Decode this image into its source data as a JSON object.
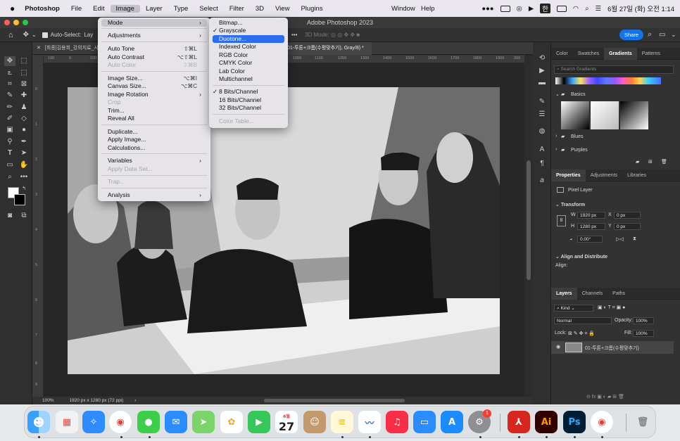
{
  "menubar": {
    "app": "Photoshop",
    "items": [
      "File",
      "Edit",
      "Image",
      "Layer",
      "Type",
      "Select",
      "Filter",
      "3D",
      "View",
      "Plugins",
      "Window",
      "Help"
    ],
    "clock": "6월 27일 (화) 오전 1:14",
    "input_badge": "한"
  },
  "window": {
    "title": "Adobe Photoshop 2023"
  },
  "options": {
    "auto_select": "Auto-Select:",
    "auto_select_value": "Lay",
    "mode3d": "3D Mode:",
    "share": "Share"
  },
  "document": {
    "tab_inactive": "[최종]김용희_강의지료_사진",
    "tab_active": "01-투톤+크롬(수평맞추기), Gray/8) *",
    "zoom": "100%",
    "doc_info": "1920 px x 1280 px (72 ppi)"
  },
  "ruler": {
    "h": [
      "100",
      "0",
      "100",
      "1000",
      "1100",
      "1200",
      "1300",
      "1400",
      "1500",
      "1600",
      "1700",
      "1800",
      "1900",
      "200"
    ],
    "v": [
      "0",
      "1",
      "2",
      "3",
      "4",
      "5",
      "6",
      "7",
      "8",
      "9",
      "1"
    ]
  },
  "image_menu": [
    {
      "label": "Mode",
      "sc": "",
      "arrow": true,
      "state": "open"
    },
    {
      "label": "Adjustments",
      "sc": "",
      "arrow": true
    },
    {
      "label": "Auto Tone",
      "sc": "⇧⌘L"
    },
    {
      "label": "Auto Contrast",
      "sc": "⌥⇧⌘L"
    },
    {
      "label": "Auto Color",
      "sc": "⇧⌘B",
      "disabled": true
    },
    {
      "label": "Image Size...",
      "sc": "⌥⌘I"
    },
    {
      "label": "Canvas Size...",
      "sc": "⌥⌘C"
    },
    {
      "label": "Image Rotation",
      "sc": "",
      "arrow": true
    },
    {
      "label": "Crop",
      "sc": "",
      "disabled": true
    },
    {
      "label": "Trim...",
      "sc": ""
    },
    {
      "label": "Reveal All",
      "sc": ""
    },
    {
      "label": "Duplicate...",
      "sc": ""
    },
    {
      "label": "Apply Image...",
      "sc": ""
    },
    {
      "label": "Calculations...",
      "sc": ""
    },
    {
      "label": "Variables",
      "sc": "",
      "arrow": true
    },
    {
      "label": "Apply Data Set...",
      "sc": "",
      "disabled": true
    },
    {
      "label": "Trap...",
      "sc": "",
      "disabled": true
    },
    {
      "label": "Analysis",
      "sc": "",
      "arrow": true
    }
  ],
  "mode_menu": [
    {
      "label": "Bitmap..."
    },
    {
      "label": "Grayscale",
      "checked": true
    },
    {
      "label": "Duotone...",
      "state": "highlighted"
    },
    {
      "label": "Indexed Color"
    },
    {
      "label": "RGB Color"
    },
    {
      "label": "CMYK Color"
    },
    {
      "label": "Lab Color"
    },
    {
      "label": "Multichannel"
    },
    {
      "label": "8 Bits/Channel",
      "checked": true
    },
    {
      "label": "16 Bits/Channel"
    },
    {
      "label": "32 Bits/Channel"
    },
    {
      "label": "Color Table...",
      "disabled": true
    }
  ],
  "panels": {
    "top_tabs": [
      "Color",
      "Swatches",
      "Gradients",
      "Patterns"
    ],
    "search_placeholder": "Search Gradients",
    "gradient_groups": [
      "Basics",
      "Blues",
      "Purples"
    ],
    "prop_tabs": [
      "Properties",
      "Adjustments",
      "Libraries"
    ],
    "pixel_layer": "Pixel Layer",
    "transform": "Transform",
    "w_label": "W",
    "w_value": "1920 px",
    "h_label": "H",
    "h_value": "1280 px",
    "x_label": "X",
    "x_value": "0 px",
    "y_label": "Y",
    "y_value": "0 px",
    "angle": "0.00°",
    "align": "Align and Distribute",
    "align_sub": "Align:",
    "layer_tabs": [
      "Layers",
      "Channels",
      "Paths"
    ],
    "kind": "Kind",
    "blend": "Normal",
    "opacity_label": "Opacity:",
    "opacity": "100%",
    "lock_label": "Lock:",
    "fill_label": "Fill:",
    "fill": "100%",
    "layer_name": "01-투톤+크롬(수평맞추기)"
  },
  "dock": {
    "calendar_month": "6월",
    "calendar_day": "27",
    "badge": "1",
    "ai": "Ai",
    "ps": "Ps"
  },
  "colors": {
    "accent": "#2a6df0",
    "share": "#1473e6",
    "ps_blue": "#31a8ff",
    "ai_orange": "#ff9a00",
    "acrobat": "#d7261f"
  }
}
